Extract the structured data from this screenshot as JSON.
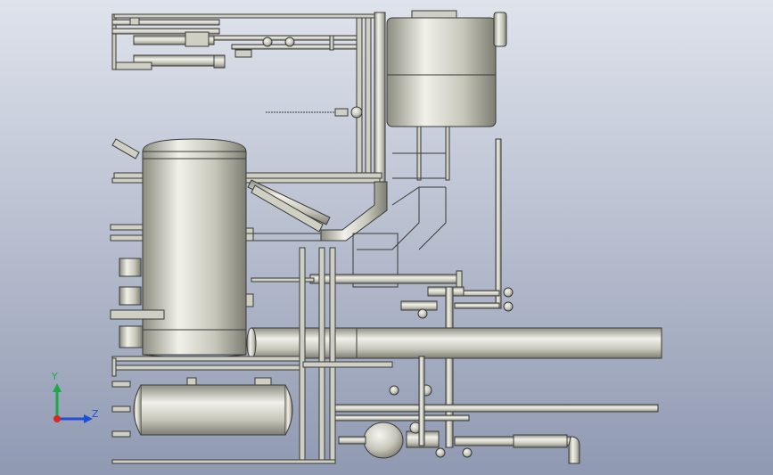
{
  "viewport": {
    "background_top": "#dfe3ec",
    "background_bottom": "#8f99b1"
  },
  "triad": {
    "y_label": "Y",
    "z_label": "Z",
    "y_color": "#1fa84a",
    "z_color": "#1f4fd6",
    "x_color": "#d62a2a"
  },
  "palette": {
    "metal_light": "#f1f1ea",
    "metal_mid": "#c6c6ba",
    "metal_dark": "#8c8c80",
    "outline": "#3a3a3a",
    "panel_fill": "#cfcfc4"
  }
}
